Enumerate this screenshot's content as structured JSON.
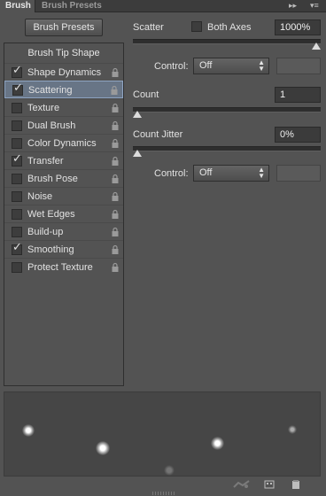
{
  "tabs": [
    {
      "label": "Brush",
      "active": true
    },
    {
      "label": "Brush Presets",
      "active": false
    }
  ],
  "tab_controls": {
    "collapse": "▸▸",
    "close": "✕",
    "menu": "▾≡"
  },
  "presets_button": "Brush Presets",
  "tip_list": {
    "header": "Brush Tip Shape",
    "items": [
      {
        "label": "Shape Dynamics",
        "checked": true,
        "selected": false
      },
      {
        "label": "Scattering",
        "checked": true,
        "selected": true
      },
      {
        "label": "Texture",
        "checked": false,
        "selected": false
      },
      {
        "label": "Dual Brush",
        "checked": false,
        "selected": false
      },
      {
        "label": "Color Dynamics",
        "checked": false,
        "selected": false
      },
      {
        "label": "Transfer",
        "checked": true,
        "selected": false
      },
      {
        "label": "Brush Pose",
        "checked": false,
        "selected": false
      },
      {
        "label": "Noise",
        "checked": false,
        "selected": false
      },
      {
        "label": "Wet Edges",
        "checked": false,
        "selected": false
      },
      {
        "label": "Build-up",
        "checked": false,
        "selected": false
      },
      {
        "label": "Smoothing",
        "checked": true,
        "selected": false
      },
      {
        "label": "Protect Texture",
        "checked": false,
        "selected": false
      }
    ]
  },
  "scatter": {
    "label": "Scatter",
    "both_axes_label": "Both Axes",
    "both_axes_checked": false,
    "value": "1000%",
    "slider_fraction": 1.0,
    "control_label": "Control:",
    "control_value": "Off"
  },
  "count": {
    "label": "Count",
    "value": "1",
    "slider_fraction": 0.0
  },
  "count_jitter": {
    "label": "Count Jitter",
    "value": "0%",
    "slider_fraction": 0.0,
    "control_label": "Control:",
    "control_value": "Off"
  },
  "colors": {
    "panel_bg": "#535353",
    "selected_row": "#687586",
    "field_bg": "#3b3b3b"
  }
}
